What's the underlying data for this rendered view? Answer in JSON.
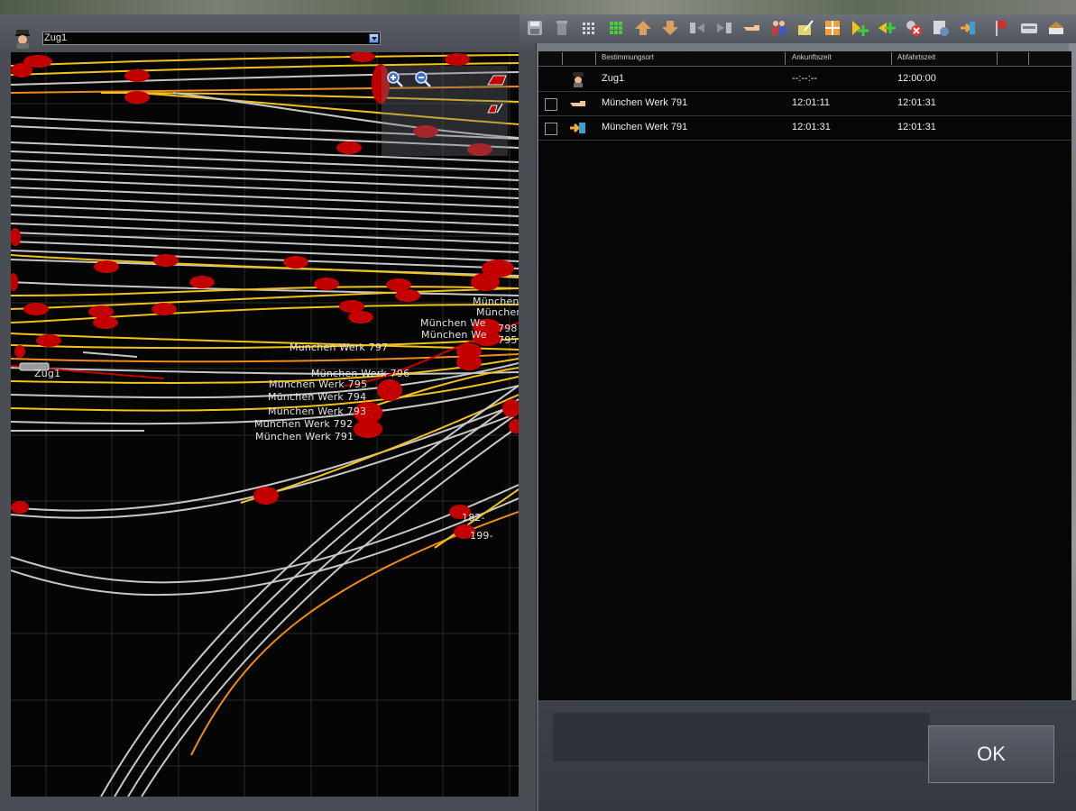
{
  "train_selector": {
    "value": "Zug1",
    "icon": "train-driver-icon"
  },
  "toolbar": {
    "icons": [
      "save-icon",
      "delete-icon",
      "grid-small-icon",
      "grid-large-icon",
      "move-up-icon",
      "move-down-icon",
      "align-left-icon",
      "align-right-icon",
      "pointing-hand-icon",
      "passengers-icon",
      "edit-schedule-icon",
      "expand-icon",
      "add-waypoint-icon",
      "add-yellow-icon",
      "remove-icon",
      "settings-icon",
      "exit-icon",
      "flag-icon",
      "wagon-icon",
      "station-icon"
    ]
  },
  "map": {
    "labels": [
      "München",
      "München",
      "München We",
      "München We",
      "München Werk 797",
      "München Werk 796",
      "München Werk 795",
      "München Werk 794",
      "München Werk 793",
      "München Werk 792",
      "München Werk 791",
      "Zug1",
      "182-",
      "199-",
      "798",
      "795"
    ],
    "colors": {
      "track": "#c7c7c7",
      "yellow": "#f2c21b",
      "orange": "#f08a1a",
      "red": "#c30000"
    }
  },
  "table": {
    "headers": [
      "Bestimmungsort",
      "Ankunftszeit",
      "Abfahrtszeit"
    ],
    "rows": [
      {
        "icon": "driver-icon",
        "has_checkbox": false,
        "destination": "Zug1",
        "arrival": "--:--:--",
        "departure": "12:00:00"
      },
      {
        "icon": "pointing-hand-icon",
        "has_checkbox": true,
        "destination": "München Werk 791",
        "arrival": "12:01:11",
        "departure": "12:01:31"
      },
      {
        "icon": "arrow-into-icon",
        "has_checkbox": true,
        "destination": "München Werk 791",
        "arrival": "12:01:31",
        "departure": "12:01:31"
      }
    ]
  },
  "ok_label": "OK"
}
